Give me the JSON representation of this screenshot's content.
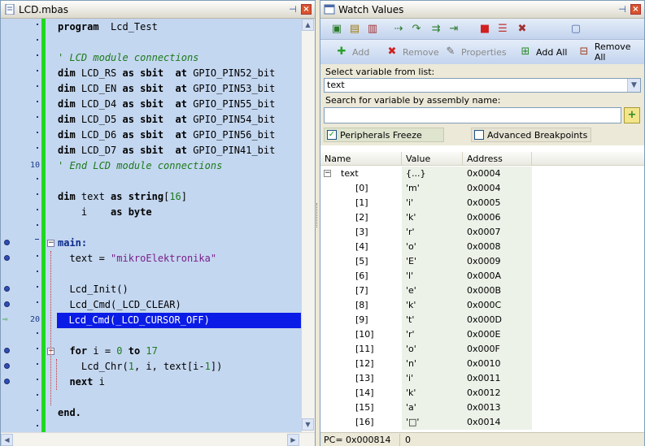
{
  "editor": {
    "tab_title": "LCD.mbas",
    "gutter": [
      {
        "mark": "dot"
      },
      {
        "mark": "dot"
      },
      {
        "mark": "dot"
      },
      {
        "mark": "dot"
      },
      {
        "mark": "dot"
      },
      {
        "mark": "dot"
      },
      {
        "mark": "dot"
      },
      {
        "mark": "dot"
      },
      {
        "mark": "dot"
      },
      {
        "mark": "num",
        "text": "10"
      },
      {
        "mark": "dot"
      },
      {
        "mark": "dot"
      },
      {
        "mark": "dot"
      },
      {
        "mark": "dot"
      },
      {
        "mark": "dash",
        "bp": true
      },
      {
        "mark": "dot",
        "bp": true
      },
      {
        "mark": "dot"
      },
      {
        "mark": "dot",
        "bp": true
      },
      {
        "mark": "dot",
        "bp": true
      },
      {
        "mark": "num",
        "text": "20",
        "arrow": true
      },
      {
        "mark": "dot"
      },
      {
        "mark": "dot",
        "bp": true
      },
      {
        "mark": "dot",
        "bp": true
      },
      {
        "mark": "dot",
        "bp": true
      },
      {
        "mark": "dot"
      },
      {
        "mark": "dot"
      },
      {
        "mark": "dot"
      }
    ],
    "lines": [
      {
        "parts": [
          [
            "kw",
            "program"
          ],
          [
            "t",
            "  Lcd_Test"
          ]
        ]
      },
      {
        "parts": []
      },
      {
        "parts": [
          [
            "cm",
            "' LCD module connections"
          ]
        ]
      },
      {
        "parts": [
          [
            "kw",
            "dim"
          ],
          [
            "t",
            " LCD_RS "
          ],
          [
            "kw",
            "as sbit"
          ],
          [
            "t",
            "  "
          ],
          [
            "kw",
            "at"
          ],
          [
            "t",
            " GPIO_PIN52_bit"
          ]
        ]
      },
      {
        "parts": [
          [
            "kw",
            "dim"
          ],
          [
            "t",
            " LCD_EN "
          ],
          [
            "kw",
            "as sbit"
          ],
          [
            "t",
            "  "
          ],
          [
            "kw",
            "at"
          ],
          [
            "t",
            " GPIO_PIN53_bit"
          ]
        ]
      },
      {
        "parts": [
          [
            "kw",
            "dim"
          ],
          [
            "t",
            " LCD_D4 "
          ],
          [
            "kw",
            "as sbit"
          ],
          [
            "t",
            "  "
          ],
          [
            "kw",
            "at"
          ],
          [
            "t",
            " GPIO_PIN55_bit"
          ]
        ]
      },
      {
        "parts": [
          [
            "kw",
            "dim"
          ],
          [
            "t",
            " LCD_D5 "
          ],
          [
            "kw",
            "as sbit"
          ],
          [
            "t",
            "  "
          ],
          [
            "kw",
            "at"
          ],
          [
            "t",
            " GPIO_PIN54_bit"
          ]
        ]
      },
      {
        "parts": [
          [
            "kw",
            "dim"
          ],
          [
            "t",
            " LCD_D6 "
          ],
          [
            "kw",
            "as sbit"
          ],
          [
            "t",
            "  "
          ],
          [
            "kw",
            "at"
          ],
          [
            "t",
            " GPIO_PIN56_bit"
          ]
        ]
      },
      {
        "parts": [
          [
            "kw",
            "dim"
          ],
          [
            "t",
            " LCD_D7 "
          ],
          [
            "kw",
            "as sbit"
          ],
          [
            "t",
            "  "
          ],
          [
            "kw",
            "at"
          ],
          [
            "t",
            " GPIO_PIN41_bit"
          ]
        ]
      },
      {
        "parts": [
          [
            "cm",
            "' End LCD module connections"
          ]
        ]
      },
      {
        "parts": []
      },
      {
        "parts": [
          [
            "kw",
            "dim"
          ],
          [
            "t",
            " text "
          ],
          [
            "kw",
            "as"
          ],
          [
            "t",
            " "
          ],
          [
            "kw",
            "string"
          ],
          [
            "t",
            "["
          ],
          [
            "num",
            "16"
          ],
          [
            "t",
            "]"
          ]
        ]
      },
      {
        "parts": [
          [
            "t",
            "    i    "
          ],
          [
            "kw",
            "as byte"
          ]
        ]
      },
      {
        "parts": []
      },
      {
        "parts": [
          [
            "kwb",
            "main:"
          ]
        ]
      },
      {
        "parts": [
          [
            "t",
            "  text = "
          ],
          [
            "str",
            "\"mikroElektronika\""
          ]
        ]
      },
      {
        "parts": []
      },
      {
        "parts": [
          [
            "t",
            "  Lcd_Init()"
          ]
        ]
      },
      {
        "parts": [
          [
            "t",
            "  Lcd_Cmd(_LCD_CLEAR)"
          ]
        ]
      },
      {
        "parts": [
          [
            "t",
            "  Lcd_Cmd(_LCD_CURSOR_OFF)"
          ]
        ],
        "highlight": true
      },
      {
        "parts": []
      },
      {
        "parts": [
          [
            "t",
            "  "
          ],
          [
            "kw",
            "for"
          ],
          [
            "t",
            " i = "
          ],
          [
            "num",
            "0"
          ],
          [
            "t",
            " "
          ],
          [
            "kw",
            "to"
          ],
          [
            "t",
            " "
          ],
          [
            "num",
            "17"
          ]
        ]
      },
      {
        "parts": [
          [
            "t",
            "    Lcd_Chr("
          ],
          [
            "num",
            "1"
          ],
          [
            "t",
            ", i, text[i-"
          ],
          [
            "num",
            "1"
          ],
          [
            "t",
            "])"
          ]
        ]
      },
      {
        "parts": [
          [
            "t",
            "  "
          ],
          [
            "kw",
            "next"
          ],
          [
            "t",
            " i"
          ]
        ]
      },
      {
        "parts": []
      },
      {
        "parts": [
          [
            "kw",
            "end."
          ]
        ]
      },
      {
        "parts": []
      }
    ]
  },
  "watch": {
    "tab_title": "Watch Values",
    "toolbar_icons": [
      "run-icon",
      "step-into-icon",
      "step-over-icon",
      "step-out-icon",
      "run-to-cursor-icon",
      "jump-icon",
      "toggle-breakpoint-icon",
      "breakpoints-list-icon",
      "clear-breakpoints-icon",
      "watch-window-icon"
    ],
    "actions": {
      "add": "Add",
      "remove": "Remove",
      "properties": "Properties",
      "add_all": "Add All",
      "remove_all": "Remove All"
    },
    "select_label": "Select variable from list:",
    "selected_variable": "text",
    "search_label": "Search for variable by assembly name:",
    "search_value": "",
    "peripherals_freeze": "Peripherals Freeze",
    "advanced_breakpoints": "Advanced Breakpoints",
    "columns": {
      "name": "Name",
      "value": "Value",
      "address": "Address"
    },
    "root": {
      "toggle": "−",
      "name": "text",
      "value": "{...}",
      "address": "0x0004"
    },
    "rows": [
      {
        "name": "[0]",
        "value": "'m'",
        "address": "0x0004"
      },
      {
        "name": "[1]",
        "value": "'i'",
        "address": "0x0005"
      },
      {
        "name": "[2]",
        "value": "'k'",
        "address": "0x0006"
      },
      {
        "name": "[3]",
        "value": "'r'",
        "address": "0x0007"
      },
      {
        "name": "[4]",
        "value": "'o'",
        "address": "0x0008"
      },
      {
        "name": "[5]",
        "value": "'E'",
        "address": "0x0009"
      },
      {
        "name": "[6]",
        "value": "'l'",
        "address": "0x000A"
      },
      {
        "name": "[7]",
        "value": "'e'",
        "address": "0x000B"
      },
      {
        "name": "[8]",
        "value": "'k'",
        "address": "0x000C"
      },
      {
        "name": "[9]",
        "value": "'t'",
        "address": "0x000D"
      },
      {
        "name": "[10]",
        "value": "'r'",
        "address": "0x000E"
      },
      {
        "name": "[11]",
        "value": "'o'",
        "address": "0x000F"
      },
      {
        "name": "[12]",
        "value": "'n'",
        "address": "0x0010"
      },
      {
        "name": "[13]",
        "value": "'i'",
        "address": "0x0011"
      },
      {
        "name": "[14]",
        "value": "'k'",
        "address": "0x0012"
      },
      {
        "name": "[15]",
        "value": "'a'",
        "address": "0x0013"
      },
      {
        "name": "[16]",
        "value": "'□'",
        "address": "0x0014"
      }
    ],
    "status_pc": "PC= 0x000814",
    "status_value": "0"
  }
}
